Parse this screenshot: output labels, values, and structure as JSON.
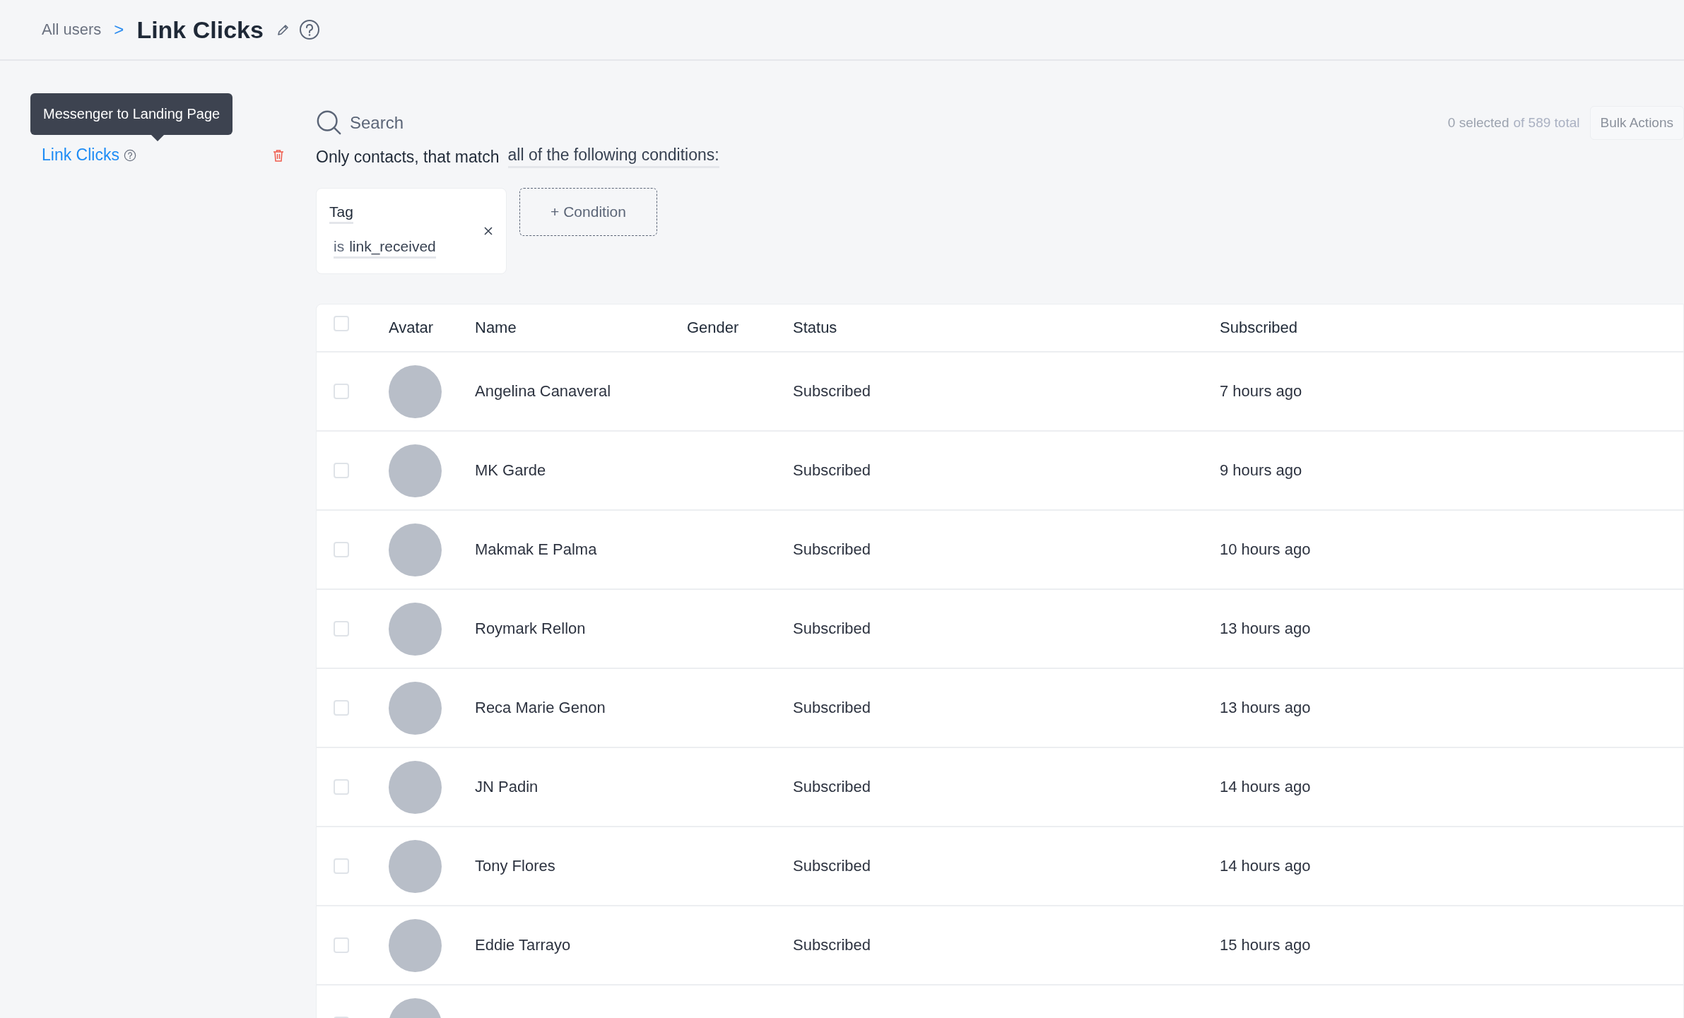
{
  "breadcrumb": {
    "parent": "All users",
    "separator": ">",
    "title": "Link Clicks"
  },
  "sidebar": {
    "tooltip": "Messenger to Landing Page",
    "items": [
      {
        "label": "Link Clicks",
        "selected": true
      }
    ]
  },
  "search": {
    "placeholder": "Search"
  },
  "selection": {
    "count": "0 selected",
    "total": "of 589 total"
  },
  "bulk_button": "Bulk Actions",
  "match": {
    "prefix": "Only contacts, that match",
    "mode": "all of the following conditions:"
  },
  "conditions": [
    {
      "field": "Tag",
      "operator": "is",
      "value": "link_received"
    }
  ],
  "add_condition": "+ Condition",
  "table": {
    "all_checked": false,
    "columns": [
      "Avatar",
      "Name",
      "Gender",
      "Status",
      "Subscribed"
    ],
    "rows": [
      {
        "checked": false,
        "name": "Angelina Canaveral",
        "status": "Subscribed",
        "subscribed": "7 hours ago"
      },
      {
        "checked": false,
        "name": "MK Garde",
        "status": "Subscribed",
        "subscribed": "9 hours ago"
      },
      {
        "checked": false,
        "name": "Makmak E Palma",
        "status": "Subscribed",
        "subscribed": "10 hours ago"
      },
      {
        "checked": false,
        "name": "Roymark Rellon",
        "status": "Subscribed",
        "subscribed": "13 hours ago"
      },
      {
        "checked": false,
        "name": "Reca Marie Genon",
        "status": "Subscribed",
        "subscribed": "13 hours ago"
      },
      {
        "checked": false,
        "name": "JN Padin",
        "status": "Subscribed",
        "subscribed": "14 hours ago"
      },
      {
        "checked": false,
        "name": "Tony Flores",
        "status": "Subscribed",
        "subscribed": "14 hours ago"
      },
      {
        "checked": false,
        "name": "Eddie Tarrayo",
        "status": "Subscribed",
        "subscribed": "15 hours ago"
      },
      {
        "checked": false
      }
    ]
  }
}
